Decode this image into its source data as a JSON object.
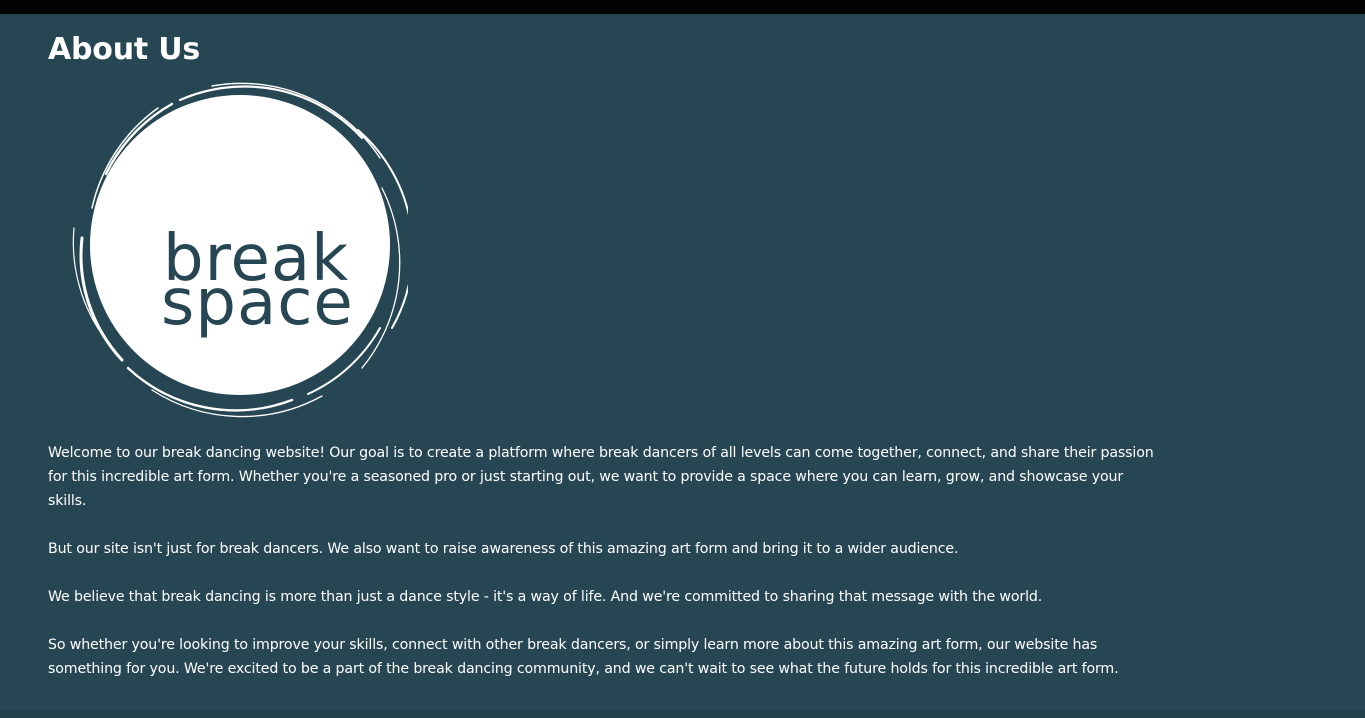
{
  "page": {
    "title": "About Us"
  },
  "logo": {
    "word_top": "break",
    "word_bottom": "space",
    "colors": {
      "circle": "#ffffff",
      "text": "#274653"
    }
  },
  "about": {
    "paragraphs": [
      "Welcome to our break dancing website! Our goal is to create a platform where break dancers of all levels can come together, connect, and share their passion for this incredible art form. Whether you're a seasoned pro or just starting out, we want to provide a space where you can learn, grow, and showcase your skills.",
      "But our site isn't just for break dancers. We also want to raise awareness of this amazing art form and bring it to a wider audience.",
      "We believe that break dancing is more than just a dance style - it's a way of life. And we're committed to sharing that message with the world.",
      "So whether you're looking to improve your skills, connect with other break dancers, or simply learn more about this amazing art form, our website has something for you. We're excited to be a part of the break dancing community, and we can't wait to see what the future holds for this incredible art form."
    ]
  },
  "theme": {
    "background": "#274653",
    "top_bar": "#020202",
    "text": "#ffffff"
  }
}
